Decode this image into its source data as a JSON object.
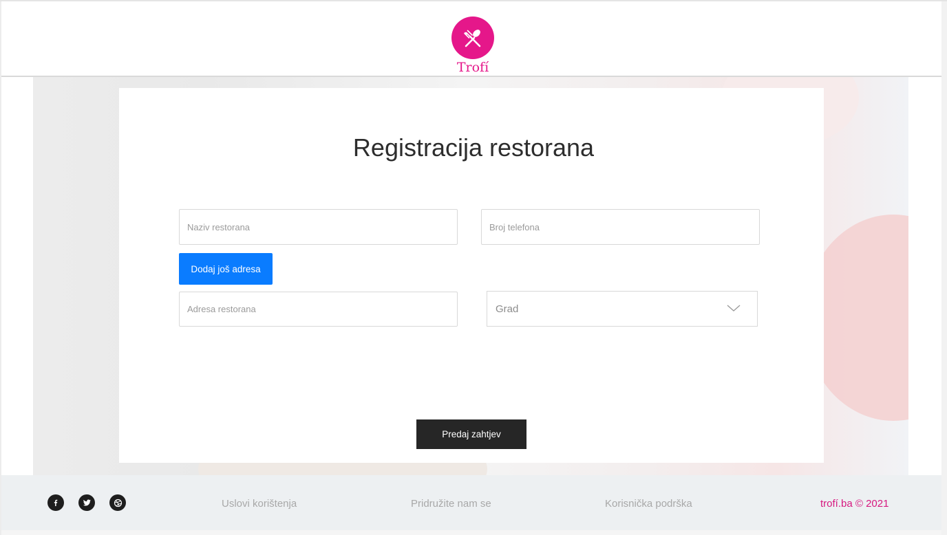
{
  "brand": {
    "name": "Trofí",
    "color": "#e5178a",
    "icon": "fork-spoon-icon"
  },
  "form": {
    "title": "Registracija restorana",
    "name_placeholder": "Naziv restorana",
    "phone_placeholder": "Broj telefona",
    "add_address_label": "Dodaj još adresa",
    "address_placeholder": "Adresa restorana",
    "city_select_value": "Grad",
    "submit_label": "Predaj zahtjev"
  },
  "colors": {
    "primary_button": "#0a7cff",
    "submit_button": "#262626",
    "footer_bg": "#edf0f2"
  },
  "footer": {
    "social": [
      "facebook-icon",
      "twitter-icon",
      "dribbble-icon"
    ],
    "links": [
      "Uslovi korištenja",
      "Pridružite nam se",
      "Korisnička podrška"
    ],
    "copyright": "trofí.ba © 2021"
  }
}
